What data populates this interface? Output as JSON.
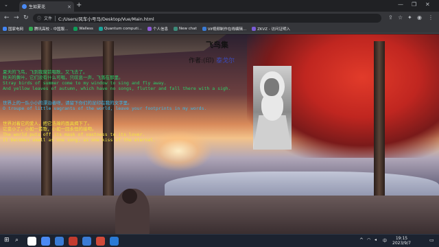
{
  "browser": {
    "tab_title": "生如夏花",
    "new_tab_symbol": "+",
    "close_symbol": "×",
    "address_label": "文件",
    "url": "C:/Users/风车小号马/Desktop/Vue/Main.html",
    "bookmarks": [
      "国家电网",
      "腾讯高校 - 中国服...",
      "Walless",
      "Quantum computi...",
      "个人信息",
      "New chat",
      "Vif视频制作在线编辑...",
      "ZKVZ - 访问证明入"
    ],
    "bookmark_colors": [
      "#4285f4",
      "#34a853",
      "#0f9d58",
      "#1aa39a",
      "#8e5bd6",
      "#3c8c7a",
      "#3a7bd5",
      "#7a5bd6"
    ]
  },
  "page": {
    "title": "飞鸟集",
    "byline_prefix": "作者:(印)",
    "byline_name": "泰戈尔",
    "poem_blocks": [
      [
        "夏天的飞鸟，飞到我窗前唱歌，又飞去了。",
        "秋天的黄叶，它们没有什么可唱，只叹息一声，飞落在那里。",
        "Stray birds of summer come to my window to sing and fly away.",
        "And yellow leaves of autumn, which have no songs, flutter and fall there with a sigh."
      ],
      [
        "世界上的一队小小的漂泊者呀，请留下你们的足印在我的文字里。",
        "O troupe of little vagrants of the world, leave your footprints in my words."
      ],
      [
        "世界对着它的爱人，把它浩瀚的面具揭下了。",
        "它变小了，小如一首歌，小如一回永恒的接吻。",
        "The world puts off its mask of vastness to its lover.",
        "It becomes small as one song, as one kiss of the eternal."
      ]
    ]
  },
  "taskbar": {
    "clock_time": "19:15",
    "clock_date": "2023/9/7",
    "lang": "中",
    "app_colors": [
      "#ffffff",
      "#4a8af4",
      "#3a7bd5",
      "#c23b2e",
      "#3a7bd5",
      "#d14a3a",
      "#2a7ad5"
    ]
  }
}
